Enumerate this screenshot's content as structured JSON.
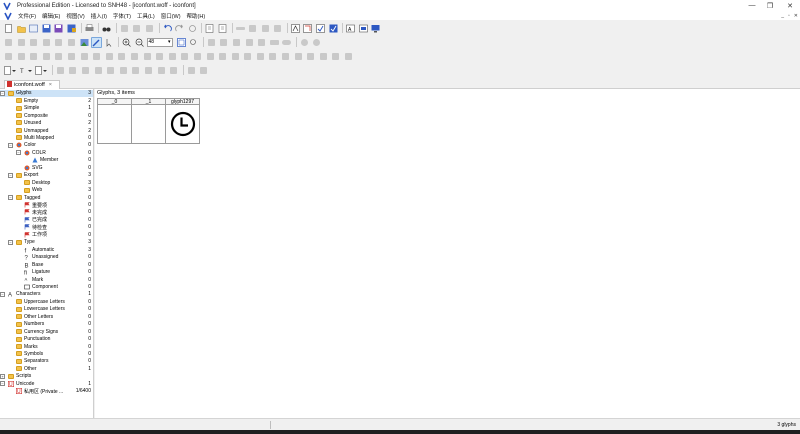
{
  "window": {
    "title": "Professional Edition - Licensed to SNH48 - [iconfont.woff - iconfont]",
    "minimize": "—",
    "maximize": "❐",
    "close": "✕"
  },
  "menu": {
    "items": [
      "文件(F)",
      "编辑(E)",
      "视图(V)",
      "插入(I)",
      "字体(T)",
      "工具(L)",
      "窗口(W)",
      "帮助(H)"
    ],
    "mdi": [
      "_",
      "▫",
      "✕"
    ]
  },
  "toolbar": {
    "zoom_value": "48"
  },
  "tab": {
    "label": "iconfont.woff",
    "close": "×"
  },
  "tree": [
    {
      "label": "Glyphs",
      "count": "3",
      "level": 0,
      "icon": "folder",
      "exp": "−",
      "sel": true
    },
    {
      "label": "Empty",
      "count": "2",
      "level": 1,
      "icon": "folder"
    },
    {
      "label": "Simple",
      "count": "1",
      "level": 1,
      "icon": "folder"
    },
    {
      "label": "Composite",
      "count": "0",
      "level": 1,
      "icon": "folder"
    },
    {
      "label": "Unused",
      "count": "2",
      "level": 1,
      "icon": "folder"
    },
    {
      "label": "Unmapped",
      "count": "2",
      "level": 1,
      "icon": "folder"
    },
    {
      "label": "Multi Mapped",
      "count": "0",
      "level": 1,
      "icon": "folder"
    },
    {
      "label": "Color",
      "count": "0",
      "level": 1,
      "icon": "color",
      "exp": "−"
    },
    {
      "label": "COLR",
      "count": "0",
      "level": 2,
      "icon": "color",
      "exp": "−"
    },
    {
      "label": "Member",
      "count": "0",
      "level": 3,
      "icon": "member"
    },
    {
      "label": "SVG",
      "count": "0",
      "level": 2,
      "icon": "color"
    },
    {
      "label": "Export",
      "count": "3",
      "level": 1,
      "icon": "folder",
      "exp": "−"
    },
    {
      "label": "Desktop",
      "count": "3",
      "level": 2,
      "icon": "folder"
    },
    {
      "label": "Web",
      "count": "3",
      "level": 2,
      "icon": "folder"
    },
    {
      "label": "Tagged",
      "count": "0",
      "level": 1,
      "icon": "folder",
      "exp": "−"
    },
    {
      "label": "重要项",
      "count": "0",
      "level": 2,
      "icon": "flag-red"
    },
    {
      "label": "未完成",
      "count": "0",
      "level": 2,
      "icon": "flag-red"
    },
    {
      "label": "已完成",
      "count": "0",
      "level": 2,
      "icon": "flag-blue"
    },
    {
      "label": "待检查",
      "count": "0",
      "level": 2,
      "icon": "flag-blue"
    },
    {
      "label": "工作项",
      "count": "0",
      "level": 2,
      "icon": "flag-red"
    },
    {
      "label": "Type",
      "count": "3",
      "level": 1,
      "icon": "folder",
      "exp": "−"
    },
    {
      "label": "Automatic",
      "count": "3",
      "level": 2,
      "icon": "type-auto"
    },
    {
      "label": "Unassigned",
      "count": "0",
      "level": 2,
      "icon": "type-q"
    },
    {
      "label": "Base",
      "count": "0",
      "level": 2,
      "icon": "type-b"
    },
    {
      "label": "Ligature",
      "count": "0",
      "level": 2,
      "icon": "type-fi"
    },
    {
      "label": "Mark",
      "count": "0",
      "level": 2,
      "icon": "type-mark"
    },
    {
      "label": "Component",
      "count": "0",
      "level": 2,
      "icon": "type-comp"
    },
    {
      "label": "Characters",
      "count": "1",
      "level": 0,
      "icon": "chars",
      "exp": "−"
    },
    {
      "label": "Uppercase Letters",
      "count": "0",
      "level": 1,
      "icon": "folder"
    },
    {
      "label": "Lowercase Letters",
      "count": "0",
      "level": 1,
      "icon": "folder"
    },
    {
      "label": "Other Letters",
      "count": "0",
      "level": 1,
      "icon": "folder"
    },
    {
      "label": "Numbers",
      "count": "0",
      "level": 1,
      "icon": "folder"
    },
    {
      "label": "Currency Signs",
      "count": "0",
      "level": 1,
      "icon": "folder"
    },
    {
      "label": "Punctuation",
      "count": "0",
      "level": 1,
      "icon": "folder"
    },
    {
      "label": "Marks",
      "count": "0",
      "level": 1,
      "icon": "folder"
    },
    {
      "label": "Symbols",
      "count": "0",
      "level": 1,
      "icon": "folder"
    },
    {
      "label": "Separators",
      "count": "0",
      "level": 1,
      "icon": "folder"
    },
    {
      "label": "Other",
      "count": "1",
      "level": 1,
      "icon": "folder"
    },
    {
      "label": "Scripts",
      "count": "",
      "level": 0,
      "icon": "folder",
      "exp": "+"
    },
    {
      "label": "Unicode",
      "count": "1",
      "level": 0,
      "icon": "unicode",
      "exp": "−"
    },
    {
      "label": "私用区 (Private ...",
      "count": "1/6400",
      "level": 1,
      "icon": "unicode"
    }
  ],
  "glyphs": {
    "header": "Glyphs, 3 items",
    "cells": [
      {
        "name": "_0"
      },
      {
        "name": "_1"
      },
      {
        "name": "glyph1297"
      }
    ]
  },
  "status": {
    "count": "3 glyphs"
  },
  "colors": {
    "folder": "#f3c24a",
    "selection": "#cde3f7",
    "flag_red": "#d0312d",
    "flag_blue": "#3b5fc0"
  }
}
